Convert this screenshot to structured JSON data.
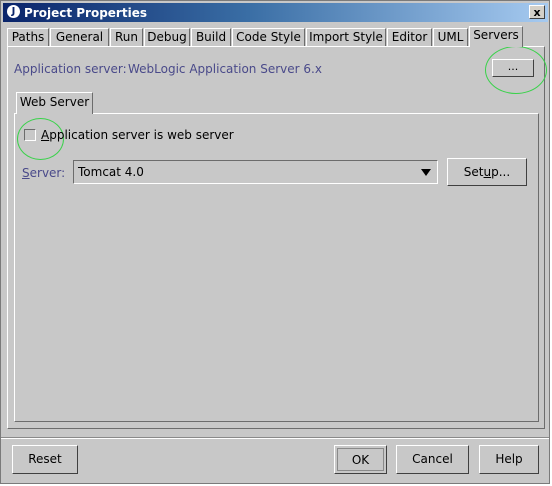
{
  "window": {
    "title": "Project Properties",
    "close_glyph": "x"
  },
  "tabs": [
    {
      "label": "Paths"
    },
    {
      "label": "General"
    },
    {
      "label": "Run"
    },
    {
      "label": "Debug"
    },
    {
      "label": "Build"
    },
    {
      "label": "Code Style"
    },
    {
      "label": "Import Style"
    },
    {
      "label": "Editor"
    },
    {
      "label": "UML"
    },
    {
      "label": "Servers",
      "active": true
    }
  ],
  "servers": {
    "app_server_label": "Application server:",
    "app_server_value": "WebLogic Application Server 6.x",
    "browse_label": "...",
    "inner_tab": "Web Server",
    "checkbox_label_mnemonic": "A",
    "checkbox_label_rest": "pplication server is web server",
    "checkbox_checked": false,
    "server_label_mnemonic": "S",
    "server_label_rest": "erver:",
    "server_value": "Tomcat 4.0",
    "setup_label_pre": "Set",
    "setup_label_mnemonic": "u",
    "setup_label_post": "p..."
  },
  "footer": {
    "reset": "Reset",
    "ok": "OK",
    "cancel": "Cancel",
    "help": "Help"
  },
  "colors": {
    "title_gradient_start": "#0a246a",
    "highlight_circle": "#39d24a",
    "label_blue": "#4a4a8a"
  }
}
